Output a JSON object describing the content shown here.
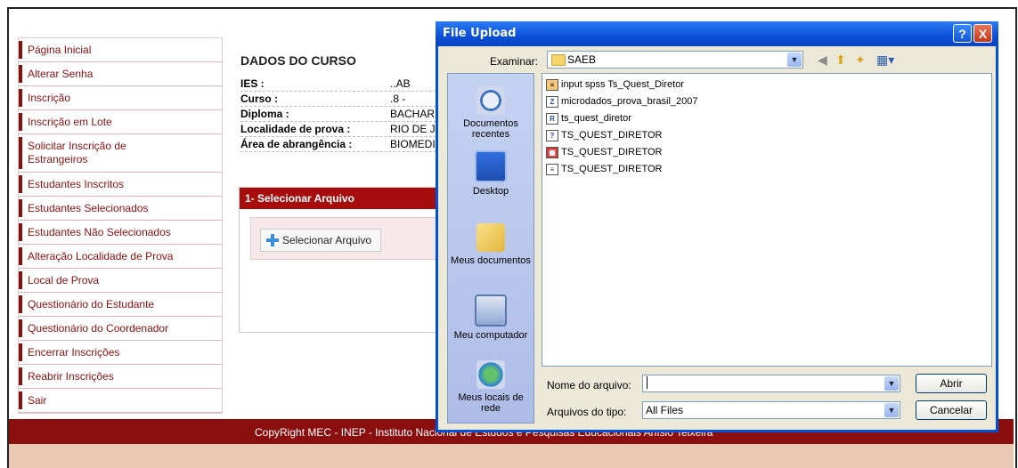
{
  "sidebar": {
    "items": [
      {
        "label": "Página Inicial"
      },
      {
        "label": "Alterar Senha"
      },
      {
        "label": "Inscrição"
      },
      {
        "label": "Inscrição em Lote"
      },
      {
        "label": "Solicitar Inscrição de Estrangeiros"
      },
      {
        "label": "Estudantes Inscritos"
      },
      {
        "label": "Estudantes Selecionados"
      },
      {
        "label": "Estudantes Não Selecionados"
      },
      {
        "label": "Alteração Localidade de Prova"
      },
      {
        "label": "Local de Prova"
      },
      {
        "label": "Questionário do Estudante"
      },
      {
        "label": "Questionário do Coordenador"
      },
      {
        "label": "Encerrar Inscrições"
      },
      {
        "label": "Reabrir Inscrições"
      },
      {
        "label": "Sair"
      }
    ]
  },
  "main": {
    "title": "DADOS DO CURSO",
    "fields": [
      {
        "key": "IES :",
        "value": "..AB"
      },
      {
        "key": "Curso :",
        "value": ".8 -"
      },
      {
        "key": "Diploma :",
        "value": "BACHAR"
      },
      {
        "key": "Localidade de prova :",
        "value": "RIO DE J"
      },
      {
        "key": "Área de abrangência :",
        "value": "BIOMEDI"
      }
    ],
    "step_title": "1- Selecionar Arquivo",
    "select_button": "Selecionar Arquivo"
  },
  "footer": {
    "text": "CopyRight MEC - INEP - Instituto Nacional de Estudos e Pesquisas Educacionais Anísio Teixeira"
  },
  "dialog": {
    "title": "File Upload",
    "help_glyph": "?",
    "close_glyph": "X",
    "look_in_label": "Examinar:",
    "look_in_value": "SAEB",
    "places": [
      {
        "label": "Documentos recentes",
        "icon": "recent-documents-icon"
      },
      {
        "label": "Desktop",
        "icon": "desktop-icon"
      },
      {
        "label": "Meus documentos",
        "icon": "my-documents-icon"
      },
      {
        "label": "Meu computador",
        "icon": "my-computer-icon"
      },
      {
        "label": "Meus locais de rede",
        "icon": "network-places-icon"
      }
    ],
    "files": [
      {
        "name": "input spss Ts_Quest_Diretor",
        "icon": "text-file-icon"
      },
      {
        "name": "microdados_prova_brasil_2007",
        "icon": "archive-file-icon"
      },
      {
        "name": "ts_quest_diretor",
        "icon": "r-file-icon"
      },
      {
        "name": "TS_QUEST_DIRETOR",
        "icon": "data-file-icon"
      },
      {
        "name": "TS_QUEST_DIRETOR",
        "icon": "table-file-icon"
      },
      {
        "name": "TS_QUEST_DIRETOR",
        "icon": "document-file-icon"
      }
    ],
    "filename_label": "Nome do arquivo:",
    "filename_value": "",
    "filetype_label": "Arquivos do tipo:",
    "filetype_value": "All Files",
    "open_button": "Abrir",
    "cancel_button": "Cancelar"
  },
  "colors": {
    "brand_red": "#8a1010",
    "titlebar_blue": "#0a4ed8",
    "footer_red": "#8b0e0e"
  }
}
